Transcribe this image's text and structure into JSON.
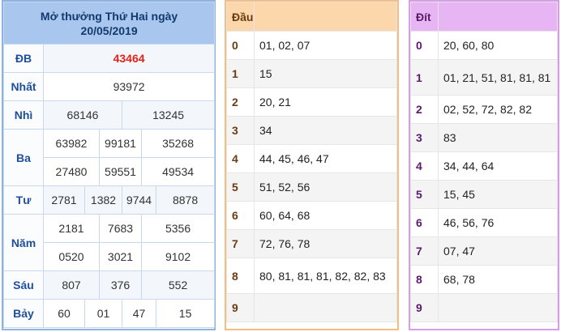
{
  "results": {
    "title_line1": "Mở thưởng Thứ Hai ngày",
    "title_line2": "20/05/2019",
    "db": {
      "label": "ĐB",
      "values": [
        "43464"
      ]
    },
    "nhat": {
      "label": "Nhất",
      "values": [
        "93972"
      ]
    },
    "nhi": {
      "label": "Nhì",
      "values": [
        "68146",
        "13245"
      ]
    },
    "ba": {
      "label": "Ba",
      "values": [
        "63982",
        "99181",
        "35268",
        "27480",
        "59551",
        "49534"
      ]
    },
    "tu": {
      "label": "Tư",
      "values": [
        "2781",
        "1382",
        "9744",
        "8878"
      ]
    },
    "nam": {
      "label": "Năm",
      "values": [
        "2181",
        "7683",
        "5356",
        "0520",
        "3021",
        "9102"
      ]
    },
    "sau": {
      "label": "Sáu",
      "values": [
        "807",
        "376",
        "552"
      ]
    },
    "bay": {
      "label": "Bảy",
      "values": [
        "60",
        "01",
        "47",
        "15"
      ]
    },
    "db_color": "#e0221b"
  },
  "head_table": {
    "header": "Đầu",
    "rows": [
      {
        "k": "0",
        "v": "01, 02, 07"
      },
      {
        "k": "1",
        "v": "15"
      },
      {
        "k": "2",
        "v": "20, 21"
      },
      {
        "k": "3",
        "v": "34"
      },
      {
        "k": "4",
        "v": "44, 45, 46, 47"
      },
      {
        "k": "5",
        "v": "51, 52, 56"
      },
      {
        "k": "6",
        "v": "60, 64, 68"
      },
      {
        "k": "7",
        "v": "72, 76, 78"
      },
      {
        "k": "8",
        "v": "80, 81, 81, 81, 82, 82, 83"
      },
      {
        "k": "9",
        "v": ""
      }
    ]
  },
  "tail_table": {
    "header": "Đít",
    "rows": [
      {
        "k": "0",
        "v": "20, 60, 80"
      },
      {
        "k": "1",
        "v": "01, 21, 51, 81, 81, 81"
      },
      {
        "k": "2",
        "v": "02, 52, 72, 82, 82"
      },
      {
        "k": "3",
        "v": "83"
      },
      {
        "k": "4",
        "v": "34, 44, 64"
      },
      {
        "k": "5",
        "v": "15, 45"
      },
      {
        "k": "6",
        "v": "46, 56, 76"
      },
      {
        "k": "7",
        "v": "07, 47"
      },
      {
        "k": "8",
        "v": "68, 78"
      },
      {
        "k": "9",
        "v": ""
      }
    ]
  }
}
